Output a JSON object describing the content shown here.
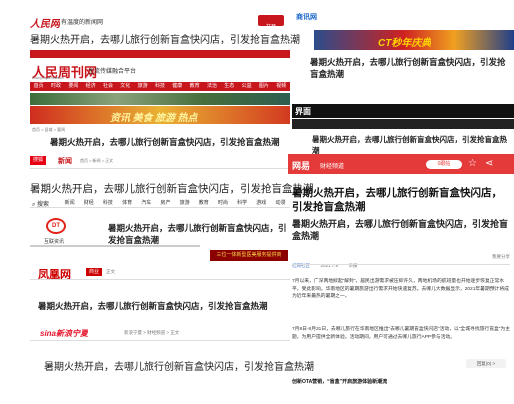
{
  "headline": "暑期火热开启，去哪儿旅行创新盲盒快闪店，引发抢盲盒热潮",
  "headline_short": "暑期火热开启，去哪儿旅行创新盲盒快闪店，引发抢盲盒热潮",
  "people": {
    "logo": "人民网",
    "tagline": "有温度的新闻网",
    "btn": "打开",
    "title": "暑期火热开启，去哪儿旅行创新盲盒快闪店，引发抢盲盒热潮"
  },
  "peoplenews": {
    "brand": "人民周刊网",
    "subtitle": "主流传媒融合平台",
    "url": "www.peoplenews.cn",
    "nav": [
      "首页",
      "时政",
      "要闻",
      "经济",
      "社会",
      "文化",
      "旅游",
      "科技",
      "健康",
      "教育",
      "法治",
      "生态",
      "公益",
      "图片",
      "视频"
    ],
    "breadcrumb": "首页 > 县域 > 要闻",
    "banner_text": "资讯 美食 旅游 热点",
    "title": "暑期火热开启，去哪儿旅行创新盲盒快闪店，引发抢盲盒热潮"
  },
  "sohu": {
    "brand": "新闻",
    "logo": "搜狐",
    "crumb": "首页 > 新闻 > 正文",
    "title": "暑期火热开启，去哪儿旅行创新盲盒快闪店，引发抢盲盒热潮"
  },
  "dt": {
    "search": "搜索",
    "nav": [
      "新闻",
      "财经",
      "科技",
      "体育",
      "汽车",
      "房产",
      "旅游",
      "教育",
      "时尚",
      "科学",
      "游戏",
      "动漫"
    ],
    "logo": "DT",
    "brand": "互联资讯",
    "title": "暑期火热开启，去哪儿旅行创新盲盒快闪店，引发抢盲盒热潮",
    "ad": "三位一体新型医美服务提供商"
  },
  "ifeng": {
    "logo": "凤凰网",
    "channel": "商业",
    "crumb": "正文",
    "title": "暑期火热开启，去哪儿旅行创新盲盒快闪店，引发抢盲盒热潮"
  },
  "sina": {
    "logo": "sina新浪宁夏",
    "crumb": "新浪宁夏 > 财经频道 > 正文",
    "title": "暑期火热开启，去哪儿旅行创新盲盒快闪店，引发抢盲盒热潮"
  },
  "sxnews": {
    "logo": "商讯网",
    "title": "暑期火热开启，去哪儿旅行创新盲盒快闪店，引发抢盲盒热潮"
  },
  "jiemian": {
    "logo": "界面",
    "sub": "新闻",
    "title": "暑期火热开启，去哪儿旅行创新盲盒快闪店，引发抢盲盒热潮"
  },
  "netease": {
    "logo": "网易",
    "channel": "财经频道",
    "btn": "0跟帖",
    "title": "暑期火热开启，去哪儿旅行创新盲盒快闪店，引发抢盲盒热潮",
    "title2": "暑期火热开启，去哪儿旅行创新盲盒快闪店，引发抢盲盒热潮",
    "source": "红网社区",
    "date": "2021.7.9",
    "tag": "举报",
    "right": "我要分享",
    "p1": "7月以来，广深两地掀起“解封”，居民出游需求被压抑许久，两地机场的航班量也开始逐步恢复正常水平。受此影响，华南地区的暑期旅游出行需求开始快速复苏。去哪儿大数据显示，2021年暑期预计将成为近年来最热的暑期之一。",
    "p2": "7月8日-8月31日，去哪儿旅行在华南地区推出“去哪儿暑期盲盒快闪店”活动，以“全城寻找旅行盲盒”为主题，为用户提供全新体验。活动期间，用户可通过去哪儿旅行APP参与活动。",
    "sub": "创新OTA营销，“盲盒”开启旅游体验新潮流",
    "reply": "回复(0) >"
  }
}
